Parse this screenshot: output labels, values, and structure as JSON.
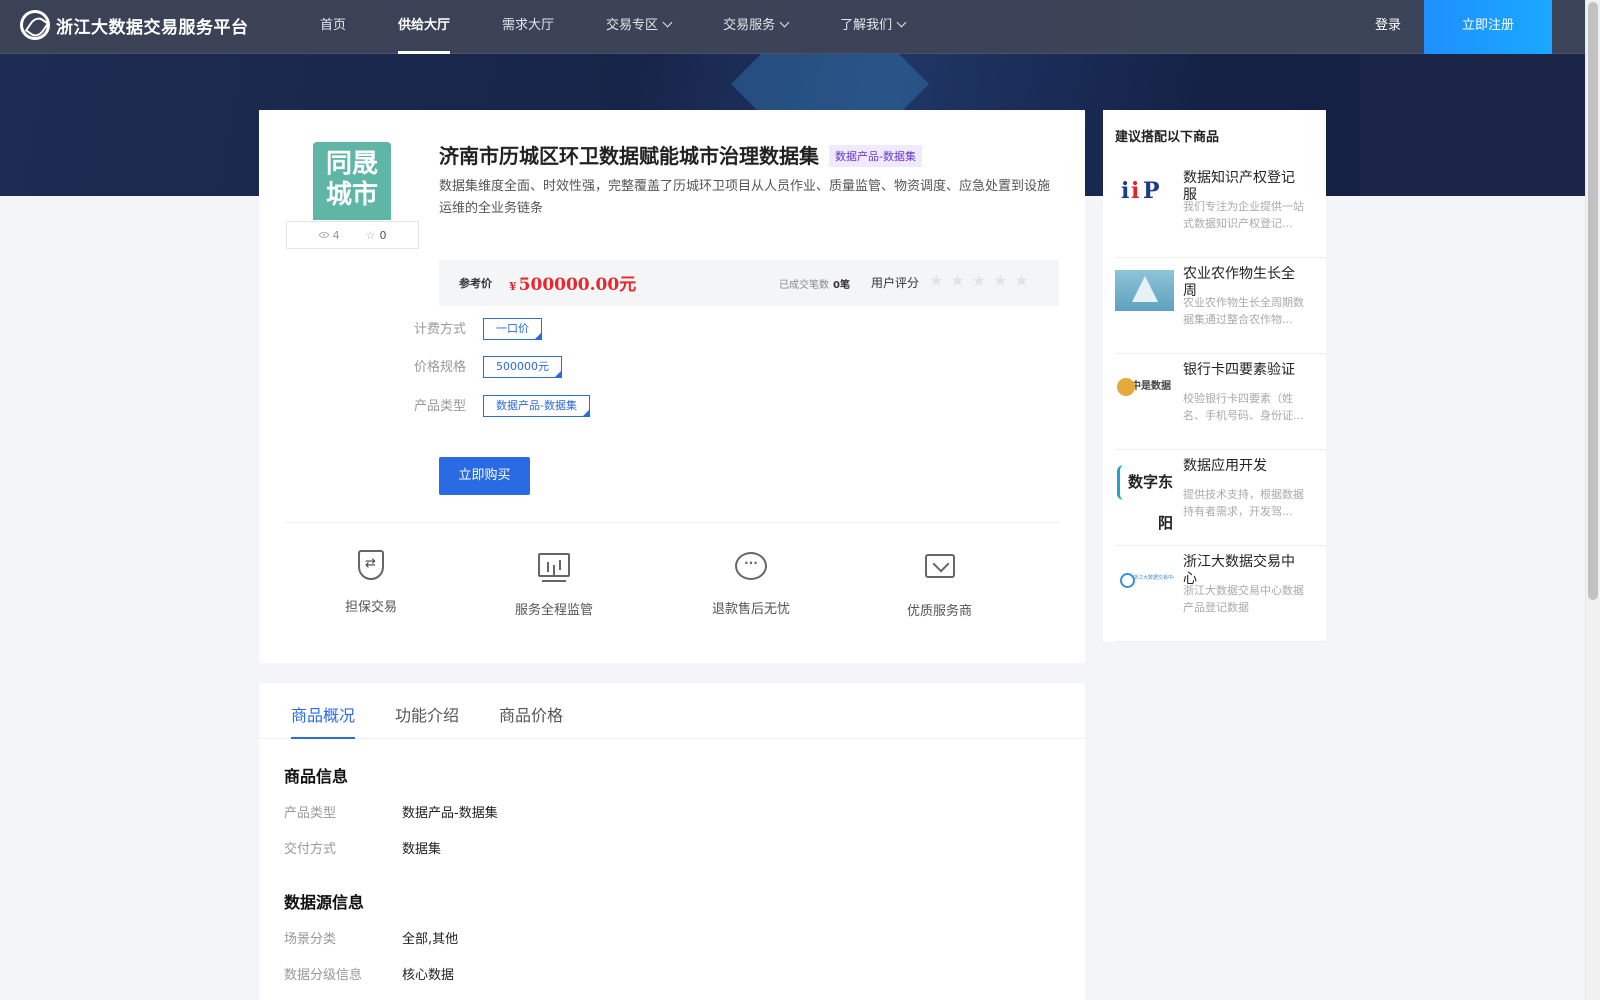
{
  "header": {
    "logo_text": "浙江大数据交易服务平台",
    "nav": [
      {
        "label": "首页",
        "active": false,
        "dropdown": false
      },
      {
        "label": "供给大厅",
        "active": true,
        "dropdown": false
      },
      {
        "label": "需求大厅",
        "active": false,
        "dropdown": false
      },
      {
        "label": "交易专区",
        "active": false,
        "dropdown": true
      },
      {
        "label": "交易服务",
        "active": false,
        "dropdown": true
      },
      {
        "label": "了解我们",
        "active": false,
        "dropdown": true
      }
    ],
    "login": "登录",
    "register": "立即注册"
  },
  "product": {
    "thumb_text_1": "同晟",
    "thumb_text_2": "城市",
    "views": "4",
    "favorites": "0",
    "title": "济南市历城区环卫数据赋能城市治理数据集",
    "tag": "数据产品-数据集",
    "description": "数据集维度全面、时效性强，完整覆盖了历城环卫项目从人员作业、质量监管、物资调度、应急处置到设施运维的全业务链条",
    "price_label": "参考价",
    "price_currency": "¥",
    "price_value": "500000.00元",
    "deals_label": "已成交笔数",
    "deals_value": "0笔",
    "rating_label": "用户评分",
    "rating_stars": 0,
    "specs": [
      {
        "label": "计费方式",
        "value": "一口价"
      },
      {
        "label": "价格规格",
        "value": "500000元"
      },
      {
        "label": "产品类型",
        "value": "数据产品-数据集"
      }
    ],
    "buy_button": "立即购买",
    "features": [
      "担保交易",
      "服务全程监管",
      "退款售后无忧",
      "优质服务商"
    ]
  },
  "sidebar": {
    "title": "建议搭配以下商品",
    "items": [
      {
        "name": "数据知识产权登记服",
        "desc": "我们专注为企业提供一站式数据知识产权登记...",
        "logo_text": "iiP"
      },
      {
        "name": "农业农作物生长全周",
        "desc": "农业农作物生长全周期数据集通过整合农作物...",
        "logo_text": ""
      },
      {
        "name": "银行卡四要素验证",
        "desc": "校验银行卡四要素（姓名、手机号码、身份证...",
        "logo_text": "中是数据"
      },
      {
        "name": "数据应用开发",
        "desc": "提供技术支持，根据数据持有者需求，开发驾...",
        "logo_text": "数字东阳"
      },
      {
        "name": "浙江大数据交易中心",
        "desc": "浙江大数据交易中心数据产品登记数据",
        "logo_text": "浙江大数据交易中心"
      }
    ]
  },
  "detail": {
    "tabs": [
      "商品概况",
      "功能介绍",
      "商品价格"
    ],
    "section1_title": "商品信息",
    "section1": [
      {
        "k": "产品类型",
        "v": "数据产品-数据集"
      },
      {
        "k": "交付方式",
        "v": "数据集"
      }
    ],
    "section2_title": "数据源信息",
    "section2": [
      {
        "k": "场景分类",
        "v": "全部,其他"
      },
      {
        "k": "数据分级信息",
        "v": "核心数据"
      }
    ]
  }
}
